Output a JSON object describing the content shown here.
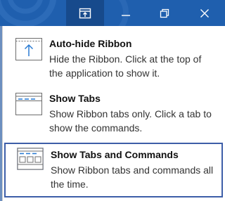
{
  "titlebar": {
    "background_color": "#1f5fae",
    "buttons": [
      {
        "icon": "ribbon-display-options-icon",
        "active": true
      },
      {
        "icon": "minimize-icon"
      },
      {
        "icon": "restore-icon"
      },
      {
        "icon": "close-icon"
      }
    ]
  },
  "menu": {
    "items": [
      {
        "title": "Auto-hide Ribbon",
        "description": "Hide the Ribbon. Click at the top of the application to show it.",
        "icon": "auto-hide-ribbon-icon",
        "selected": false
      },
      {
        "title": "Show Tabs",
        "description": "Show Ribbon tabs only. Click a tab to show the commands.",
        "icon": "show-tabs-icon",
        "selected": false
      },
      {
        "title": "Show Tabs and Commands",
        "description": "Show Ribbon tabs and commands all the time.",
        "icon": "show-tabs-and-commands-icon",
        "selected": true
      }
    ],
    "selection_color": "#3d5ea8"
  }
}
